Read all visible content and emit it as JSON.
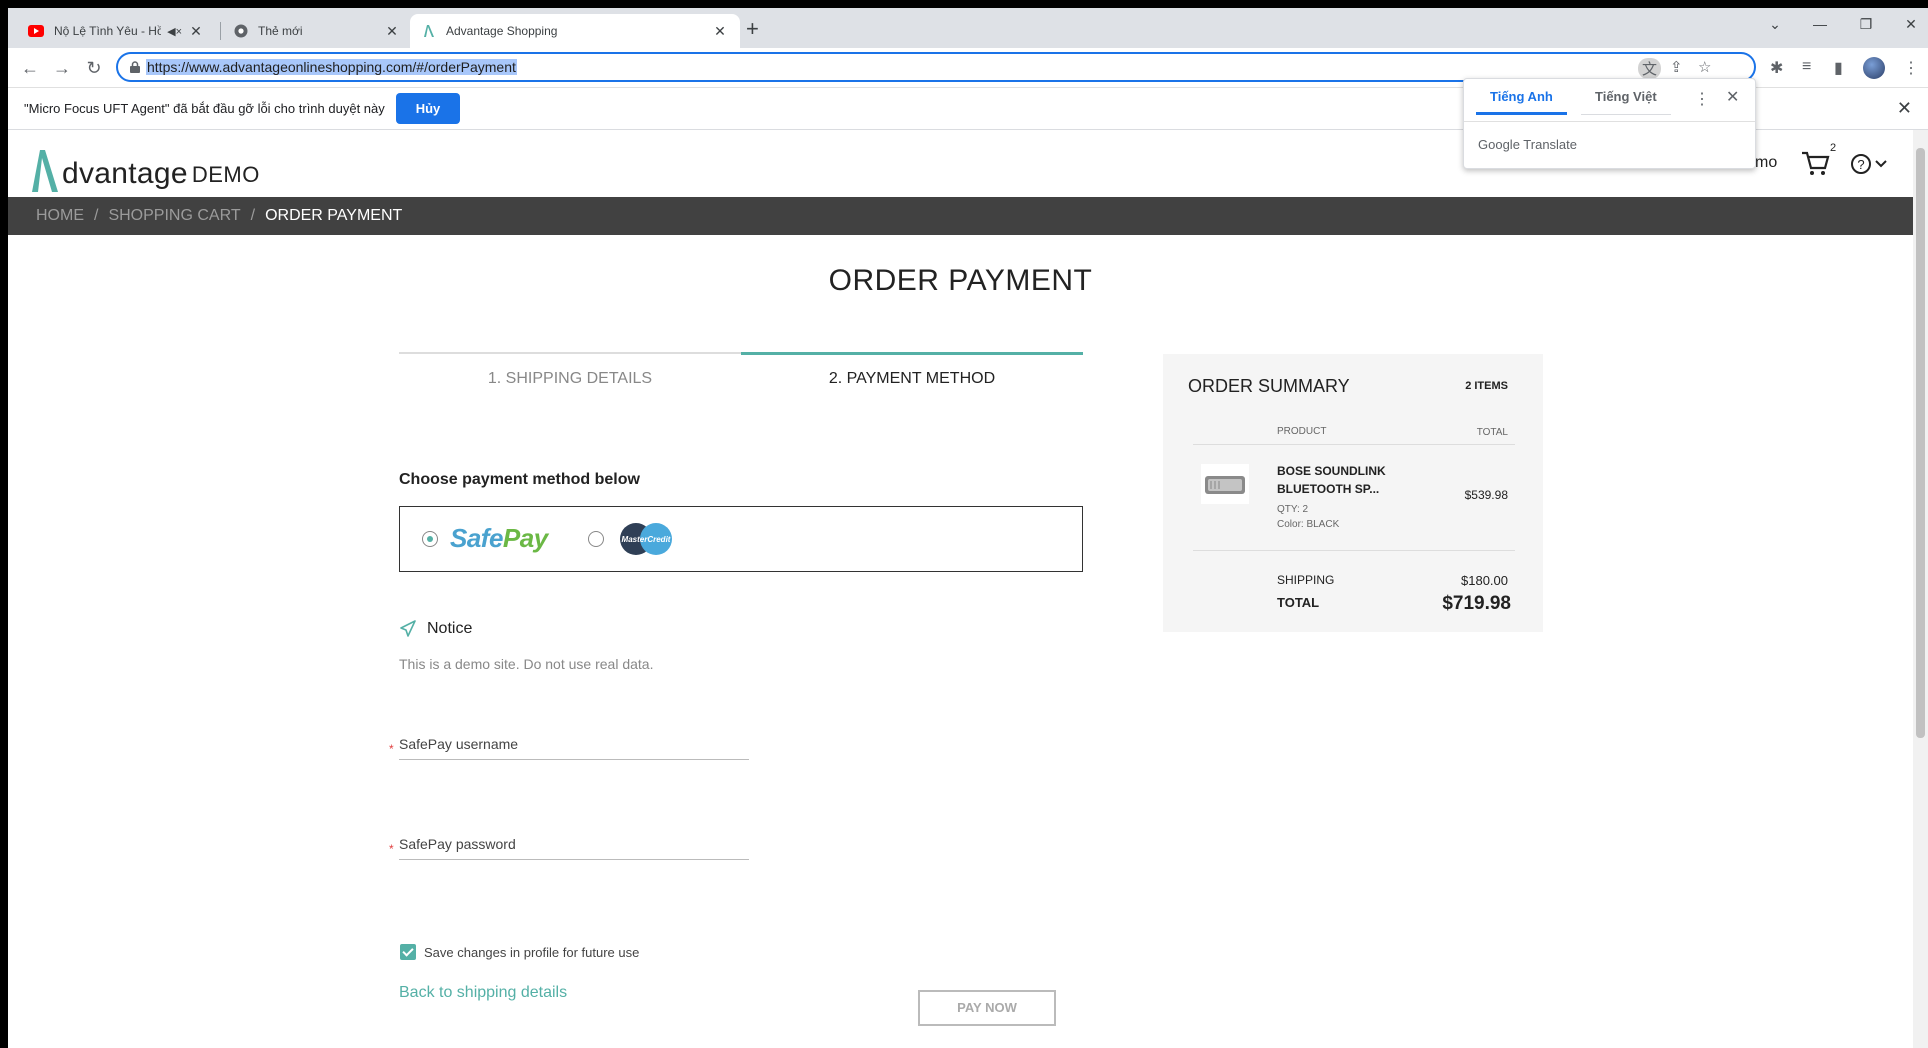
{
  "browser": {
    "tabs": [
      {
        "title": "Nộ Lệ Tình Yêu - Hồ Việt Trung",
        "icon": "youtube-icon",
        "audio_icon": "speaker-muted-icon"
      },
      {
        "title": "Thẻ mới",
        "icon": "chrome-icon"
      },
      {
        "title": "Advantage Shopping",
        "icon": "advantage-icon"
      }
    ],
    "new_tab": "+",
    "url": "https://www.advantageonlineshopping.com/#/orderPayment"
  },
  "infobar": {
    "message": "\"Micro Focus UFT Agent\" đã bắt đầu gỡ lỗi cho trình duyệt này",
    "cancel_label": "Hủy"
  },
  "translate_popup": {
    "tab_source": "Tiếng Anh",
    "tab_target": "Tiếng Việt",
    "brand": "Google Translate"
  },
  "site": {
    "logo_word": "dvantage",
    "logo_demo": "DEMO",
    "user_fragment": "mo",
    "cart_count": "2"
  },
  "breadcrumb": {
    "items": [
      "HOME",
      "SHOPPING CART",
      "ORDER PAYMENT"
    ],
    "separator": "/"
  },
  "page": {
    "title": "ORDER PAYMENT",
    "steps": [
      "1. SHIPPING DETAILS",
      "2. PAYMENT METHOD"
    ],
    "choose_label": "Choose payment method below",
    "payment_options": {
      "safepay_safe": "Safe",
      "safepay_pay": "Pay",
      "mastercredit": "MasterCredit",
      "selected": "SafePay"
    },
    "notice_title": "Notice",
    "notice_text": "This is a demo site. Do not use real data.",
    "fields": {
      "username_label": "SafePay username",
      "password_label": "SafePay password",
      "required_mark": "*"
    },
    "save_label": "Save changes in profile for future use",
    "save_checked": true,
    "back_link": "Back to shipping details",
    "pay_now": "PAY NOW"
  },
  "summary": {
    "title": "ORDER SUMMARY",
    "item_count": "2 ITEMS",
    "col_product": "PRODUCT",
    "col_total": "TOTAL",
    "product_name": "BOSE SOUNDLINK BLUETOOTH SP...",
    "product_qty": "QTY: 2",
    "product_color": "Color: BLACK",
    "product_price": "$539.98",
    "shipping_label": "SHIPPING",
    "shipping_value": "$180.00",
    "total_label": "TOTAL",
    "total_value": "$719.98"
  },
  "colors": {
    "accent": "#54b0a6",
    "breadcrumb_bg": "#414141",
    "chrome_blue": "#1a73e8"
  }
}
